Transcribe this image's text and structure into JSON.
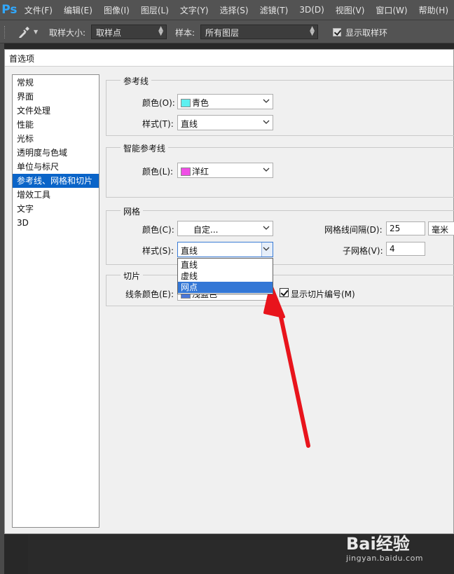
{
  "app": {
    "logo": "Ps"
  },
  "menu": [
    "文件(F)",
    "编辑(E)",
    "图像(I)",
    "图层(L)",
    "文字(Y)",
    "选择(S)",
    "滤镜(T)",
    "3D(D)",
    "视图(V)",
    "窗口(W)",
    "帮助(H)"
  ],
  "options_bar": {
    "sample_size_label": "取样大小:",
    "sample_size_value": "取样点",
    "sample_label": "样本:",
    "sample_value": "所有图层",
    "show_ring_label": "显示取样环",
    "show_ring_checked": true
  },
  "dialog": {
    "title": "首选项",
    "categories": [
      "常规",
      "界面",
      "文件处理",
      "性能",
      "光标",
      "透明度与色域",
      "单位与标尺",
      "参考线、网格和切片",
      "增效工具",
      "文字",
      "3D"
    ],
    "selected_category": "参考线、网格和切片",
    "guides": {
      "legend": "参考线",
      "color_label": "颜色(O):",
      "color_value": "青色",
      "color_swatch": "#5ef0f0",
      "style_label": "样式(T):",
      "style_value": "直线"
    },
    "smart_guides": {
      "legend": "智能参考线",
      "color_label": "颜色(L):",
      "color_value": "洋红",
      "color_swatch": "#f04ee6"
    },
    "grid": {
      "legend": "网格",
      "color_label": "颜色(C):",
      "color_value": "自定...",
      "style_label": "样式(S):",
      "style_value": "直线",
      "style_options": [
        "直线",
        "虚线",
        "网点"
      ],
      "highlighted_option": "网点",
      "gridline_every_label": "网格线间隔(D):",
      "gridline_every_value": "25",
      "gridline_unit": "毫米",
      "subdivisions_label": "子网格(V):",
      "subdivisions_value": "4"
    },
    "slices": {
      "legend": "切片",
      "line_color_label": "线条颜色(E):",
      "line_color_value": "浅蓝色",
      "line_color_swatch": "#4a78d8",
      "show_numbers_label": "显示切片编号(M)",
      "show_numbers_checked": true
    }
  },
  "annotation": {
    "arrow_color": "#e8141c"
  },
  "watermark": {
    "brand": "Bai经验",
    "url": "jingyan.baidu.com"
  }
}
